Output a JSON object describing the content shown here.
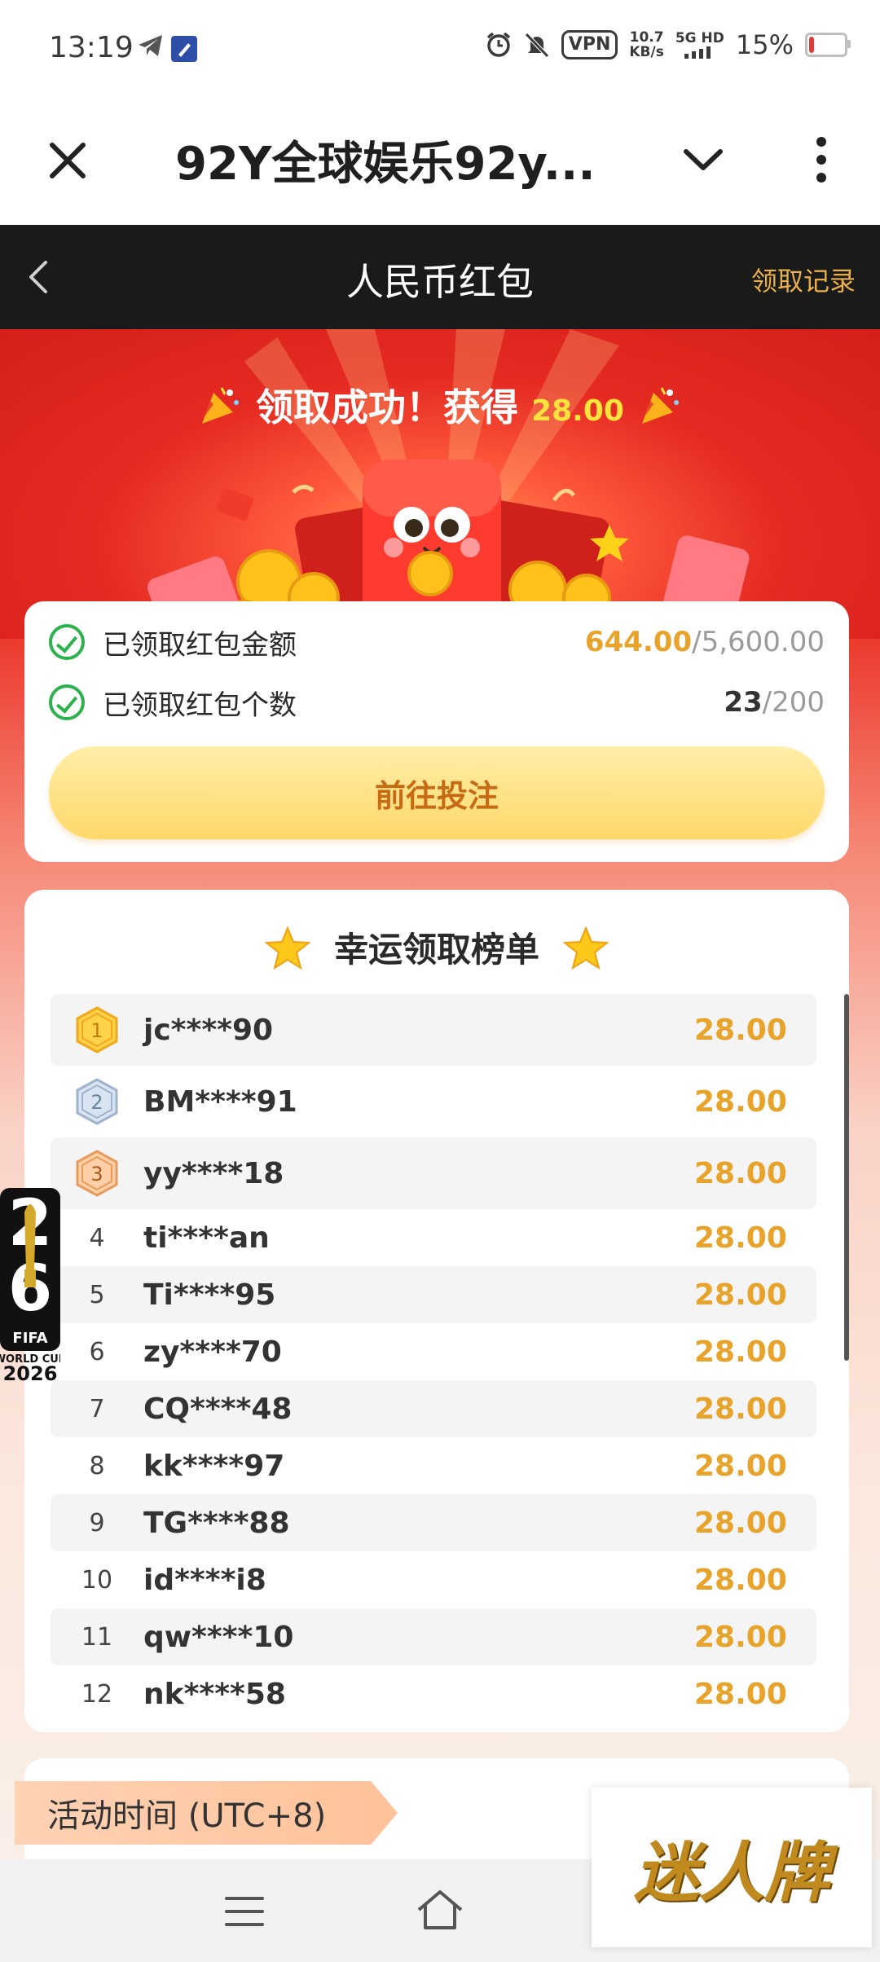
{
  "status_bar": {
    "time": "13:19",
    "net_speed_top": "10.7",
    "net_speed_bottom": "KB/s",
    "vpn": "VPN",
    "signal_label": "5G HD",
    "battery": "15%",
    "battery_level": 0.15
  },
  "browser": {
    "title": "92Y全球娱乐92y..."
  },
  "header": {
    "title": "人民币红包",
    "records_link": "领取记录"
  },
  "hero": {
    "success_text": "领取成功！获得",
    "success_amount": "28.00"
  },
  "summary": {
    "amount_label": "已领取红包金额",
    "amount_current": "644.00",
    "amount_total": "/5,600.00",
    "count_label": "已领取红包个数",
    "count_current": "23",
    "count_total": "/200",
    "button": "前往投注"
  },
  "leaderboard": {
    "title": "幸运领取榜单",
    "rows": [
      {
        "rank": "1",
        "user": "jc****90",
        "amount": "28.00"
      },
      {
        "rank": "2",
        "user": "BM****91",
        "amount": "28.00"
      },
      {
        "rank": "3",
        "user": "yy****18",
        "amount": "28.00"
      },
      {
        "rank": "4",
        "user": "ti****an",
        "amount": "28.00"
      },
      {
        "rank": "5",
        "user": "Ti****95",
        "amount": "28.00"
      },
      {
        "rank": "6",
        "user": "zy****70",
        "amount": "28.00"
      },
      {
        "rank": "7",
        "user": "CQ****48",
        "amount": "28.00"
      },
      {
        "rank": "8",
        "user": "kk****97",
        "amount": "28.00"
      },
      {
        "rank": "9",
        "user": "TG****88",
        "amount": "28.00"
      },
      {
        "rank": "10",
        "user": "id****i8",
        "amount": "28.00"
      },
      {
        "rank": "11",
        "user": "qw****10",
        "amount": "28.00"
      },
      {
        "rank": "12",
        "user": "nk****58",
        "amount": "28.00"
      }
    ]
  },
  "activity": {
    "tab_label": "活动时间 (UTC+8)"
  },
  "badges": {
    "world_cup_fifa": "FIFA",
    "world_cup_text": "WORLD CUP",
    "world_cup_year": "2026",
    "brand": "迷人牌"
  },
  "colors": {
    "header_bg": "#1a1a1a",
    "accent_gold": "#e8a32a",
    "hero_red": "#e52a22",
    "check_green": "#2bb24c"
  }
}
